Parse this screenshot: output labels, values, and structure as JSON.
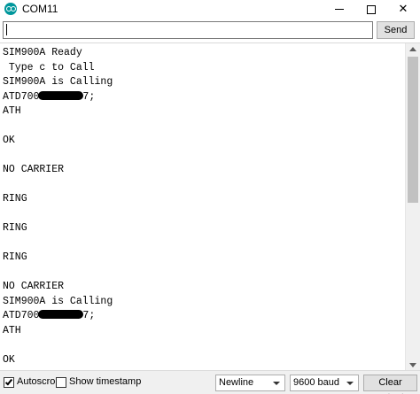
{
  "window": {
    "title": "COM11",
    "app_icon": "arduino-icon",
    "controls": {
      "minimize": "minimize-icon",
      "maximize": "maximize-icon",
      "close_glyph": "✕"
    }
  },
  "input": {
    "value": "",
    "placeholder": ""
  },
  "send_button": {
    "label": "Send"
  },
  "output": {
    "lines": [
      {
        "text": "SIM900A Ready"
      },
      {
        "text": " Type c to Call"
      },
      {
        "text": "SIM900A is Calling"
      },
      {
        "prefix": "ATD700",
        "suffix": "7;",
        "redacted": true
      },
      {
        "text": "ATH"
      },
      {
        "text": ""
      },
      {
        "text": "OK"
      },
      {
        "text": ""
      },
      {
        "text": "NO CARRIER"
      },
      {
        "text": ""
      },
      {
        "text": "RING"
      },
      {
        "text": ""
      },
      {
        "text": "RING"
      },
      {
        "text": ""
      },
      {
        "text": "RING"
      },
      {
        "text": ""
      },
      {
        "text": "NO CARRIER"
      },
      {
        "text": "SIM900A is Calling"
      },
      {
        "prefix": "ATD700",
        "suffix": "7;",
        "redacted": true
      },
      {
        "text": "ATH"
      },
      {
        "text": ""
      },
      {
        "text": "OK"
      }
    ]
  },
  "footer": {
    "autoscroll": {
      "label": "Autoscroll",
      "checked": true
    },
    "timestamp": {
      "label": "Show timestamp",
      "checked": false
    },
    "line_ending": {
      "selected": "Newline"
    },
    "baud_rate": {
      "selected": "9600 baud"
    },
    "clear_button": {
      "label": "Clear output"
    }
  },
  "colors": {
    "app_icon": "#00979c",
    "button_face": "#e1e1e1",
    "footer_bg": "#f0f0f0"
  }
}
